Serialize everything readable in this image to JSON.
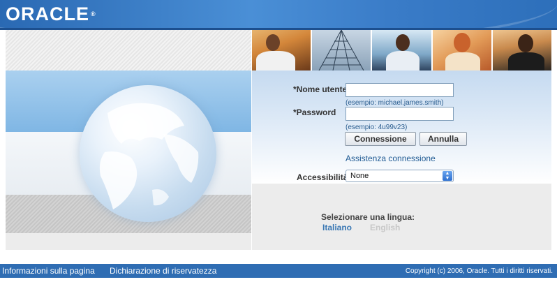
{
  "header": {
    "logo": "ORACLE",
    "logo_mark": "®"
  },
  "login": {
    "username_label": "*Nome utente",
    "username_value": "",
    "username_hint": "(esempio: michael.james.smith)",
    "password_label": "*Password",
    "password_value": "",
    "password_hint": "(esempio: 4u99v23)",
    "connect_button": "Connessione",
    "cancel_button": "Annulla",
    "help_link": "Assistenza connessione",
    "accessibility_label": "Accessibilità",
    "accessibility_value": "None"
  },
  "language": {
    "title": "Selezionare una lingua:",
    "options": [
      "Italiano",
      "English"
    ]
  },
  "footer": {
    "page_info": "Informazioni sulla pagina",
    "privacy": "Dichiarazione di riservatezza",
    "copyright": "Copyright (c) 2006, Oracle. Tutti i diritti riservati."
  },
  "colors": {
    "brand_blue": "#2f6db3",
    "link": "#1f5a93",
    "language_active": "#3b78b4"
  }
}
